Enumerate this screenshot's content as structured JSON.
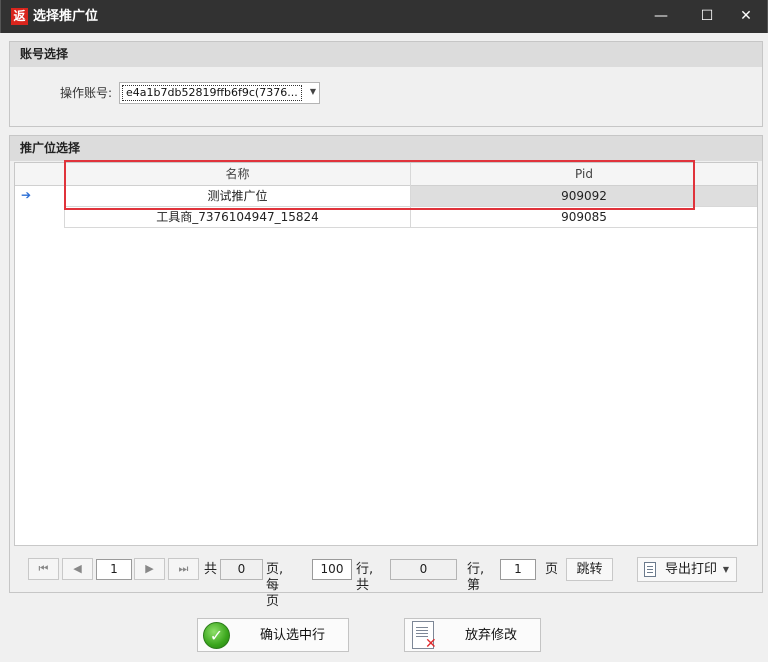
{
  "window": {
    "app_icon_text": "返",
    "title": "选择推广位",
    "minimize_glyph": "—",
    "maximize_glyph": "☐",
    "close_glyph": "✕"
  },
  "account_group": {
    "header": "账号选择",
    "label": "操作账号:",
    "selected_value": "e4a1b7db52819ffb6f9c(7376..."
  },
  "slot_group": {
    "header": "推广位选择",
    "columns": [
      "名称",
      "Pid"
    ],
    "rows": [
      {
        "name": "测试推广位",
        "pid": "909092",
        "selected": true,
        "indicator": "➔"
      },
      {
        "name": "工具商_7376104947_15824",
        "pid": "909085",
        "selected": false,
        "indicator": ""
      }
    ]
  },
  "pager": {
    "first_icon": "first-page-icon",
    "prev_icon": "prev-page-icon",
    "next_icon": "next-page-icon",
    "last_icon": "last-page-icon",
    "current_page": "1",
    "total_label": "共",
    "total_pages": "0",
    "per_page_label": "页,每页",
    "page_size": "100",
    "rows_total_label": "行,共",
    "total_rows": "0",
    "goto_label": "行,第",
    "goto_page": "1",
    "page_suffix": "页",
    "jump_label": "跳转",
    "export_label": "导出打印"
  },
  "actions": {
    "confirm_label": "确认选中行",
    "discard_label": "放弃修改"
  },
  "colors": {
    "titlebar": "#323232",
    "highlight": "#e0333b",
    "app_icon": "#d9251d"
  }
}
